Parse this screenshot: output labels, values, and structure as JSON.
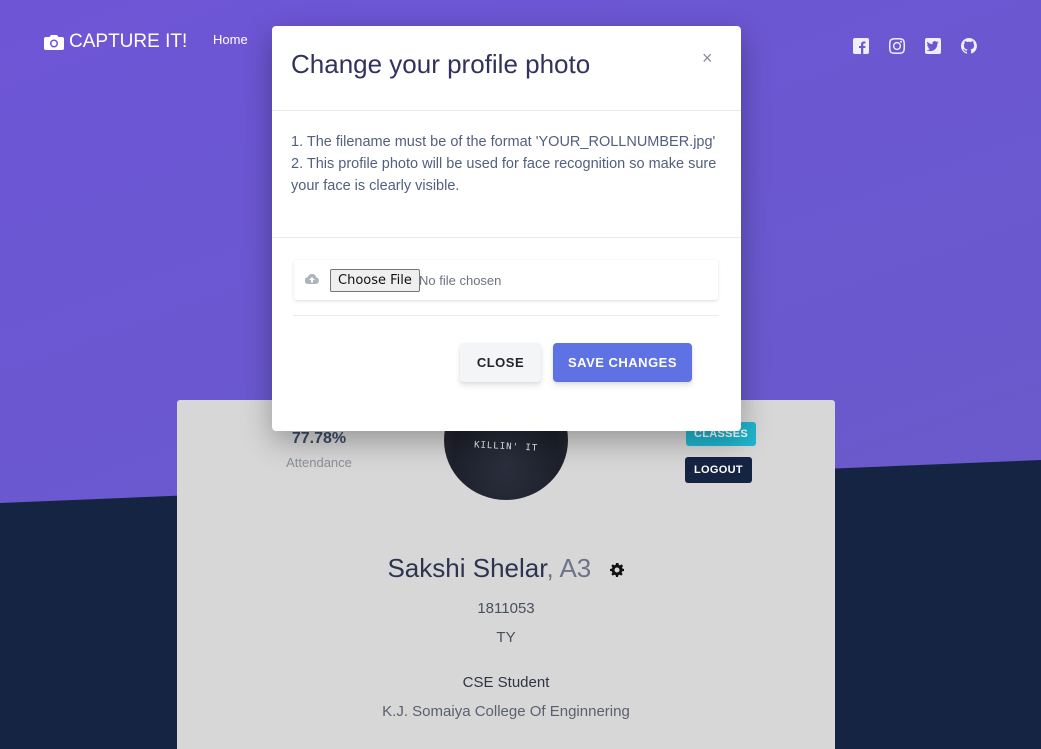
{
  "navbar": {
    "brand": "CAPTURE IT!",
    "home_label": "Home",
    "socials": [
      "facebook-icon",
      "instagram-icon",
      "twitter-icon",
      "github-icon"
    ]
  },
  "profile": {
    "attendance_value": "77.78%",
    "attendance_label": "Attendance",
    "classes_label": "CLASSES",
    "logout_label": "LOGOUT",
    "avatar_shirt_text": "KILLIN' IT",
    "name": "Sakshi Shelar",
    "name_sep": ", ",
    "division": "A3",
    "roll_number": "1811053",
    "year": "TY",
    "role": "CSE Student",
    "college": "K.J. Somaiya College Of Enginnering"
  },
  "modal": {
    "title": "Change your profile photo",
    "close_symbol": "×",
    "instruction_1": "1. The filename must be of the format 'YOUR_ROLLNUMBER.jpg'",
    "instruction_2": "2. This profile photo will be used for face recognition so make sure your face is clearly visible.",
    "choose_file_label": "Choose File",
    "no_file_text": "No file chosen",
    "close_button": "CLOSE",
    "save_button": "SAVE CHANGES"
  },
  "colors": {
    "primary": "#5e72e4",
    "info": "#1fb6cf",
    "dark": "#152443",
    "purple_bg": "#6a59cf"
  }
}
